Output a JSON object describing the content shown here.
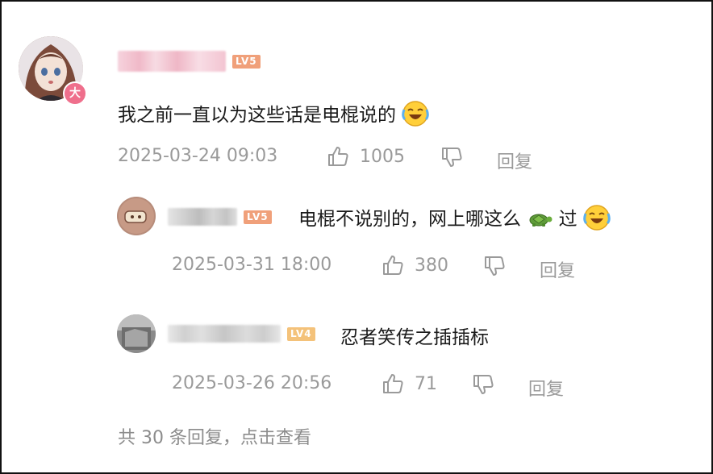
{
  "comments": [
    {
      "level": "LV5",
      "level_color": "#f0a07a",
      "text": "我之前一直以为这些话是电棍说的",
      "timestamp": "2025-03-24 09:03",
      "likes": "1005",
      "reply_label": "回复",
      "avatar_badge": "大",
      "emoji": "laughing-crying-face"
    },
    {
      "level": "LV5",
      "level_color": "#f0a07a",
      "text": "电棍不说别的，网上哪这么",
      "text_tail": "过",
      "timestamp": "2025-03-31 18:00",
      "likes": "380",
      "reply_label": "回复",
      "emoji_mid": "turtle",
      "emoji": "laughing-crying-face"
    },
    {
      "level": "LV4",
      "level_color": "#f4c27a",
      "text": "忍者笑传之插插标",
      "timestamp": "2025-03-26 20:56",
      "likes": "71",
      "reply_label": "回复"
    }
  ],
  "footer": {
    "replies_summary": "共 30 条回复，点击查看"
  }
}
